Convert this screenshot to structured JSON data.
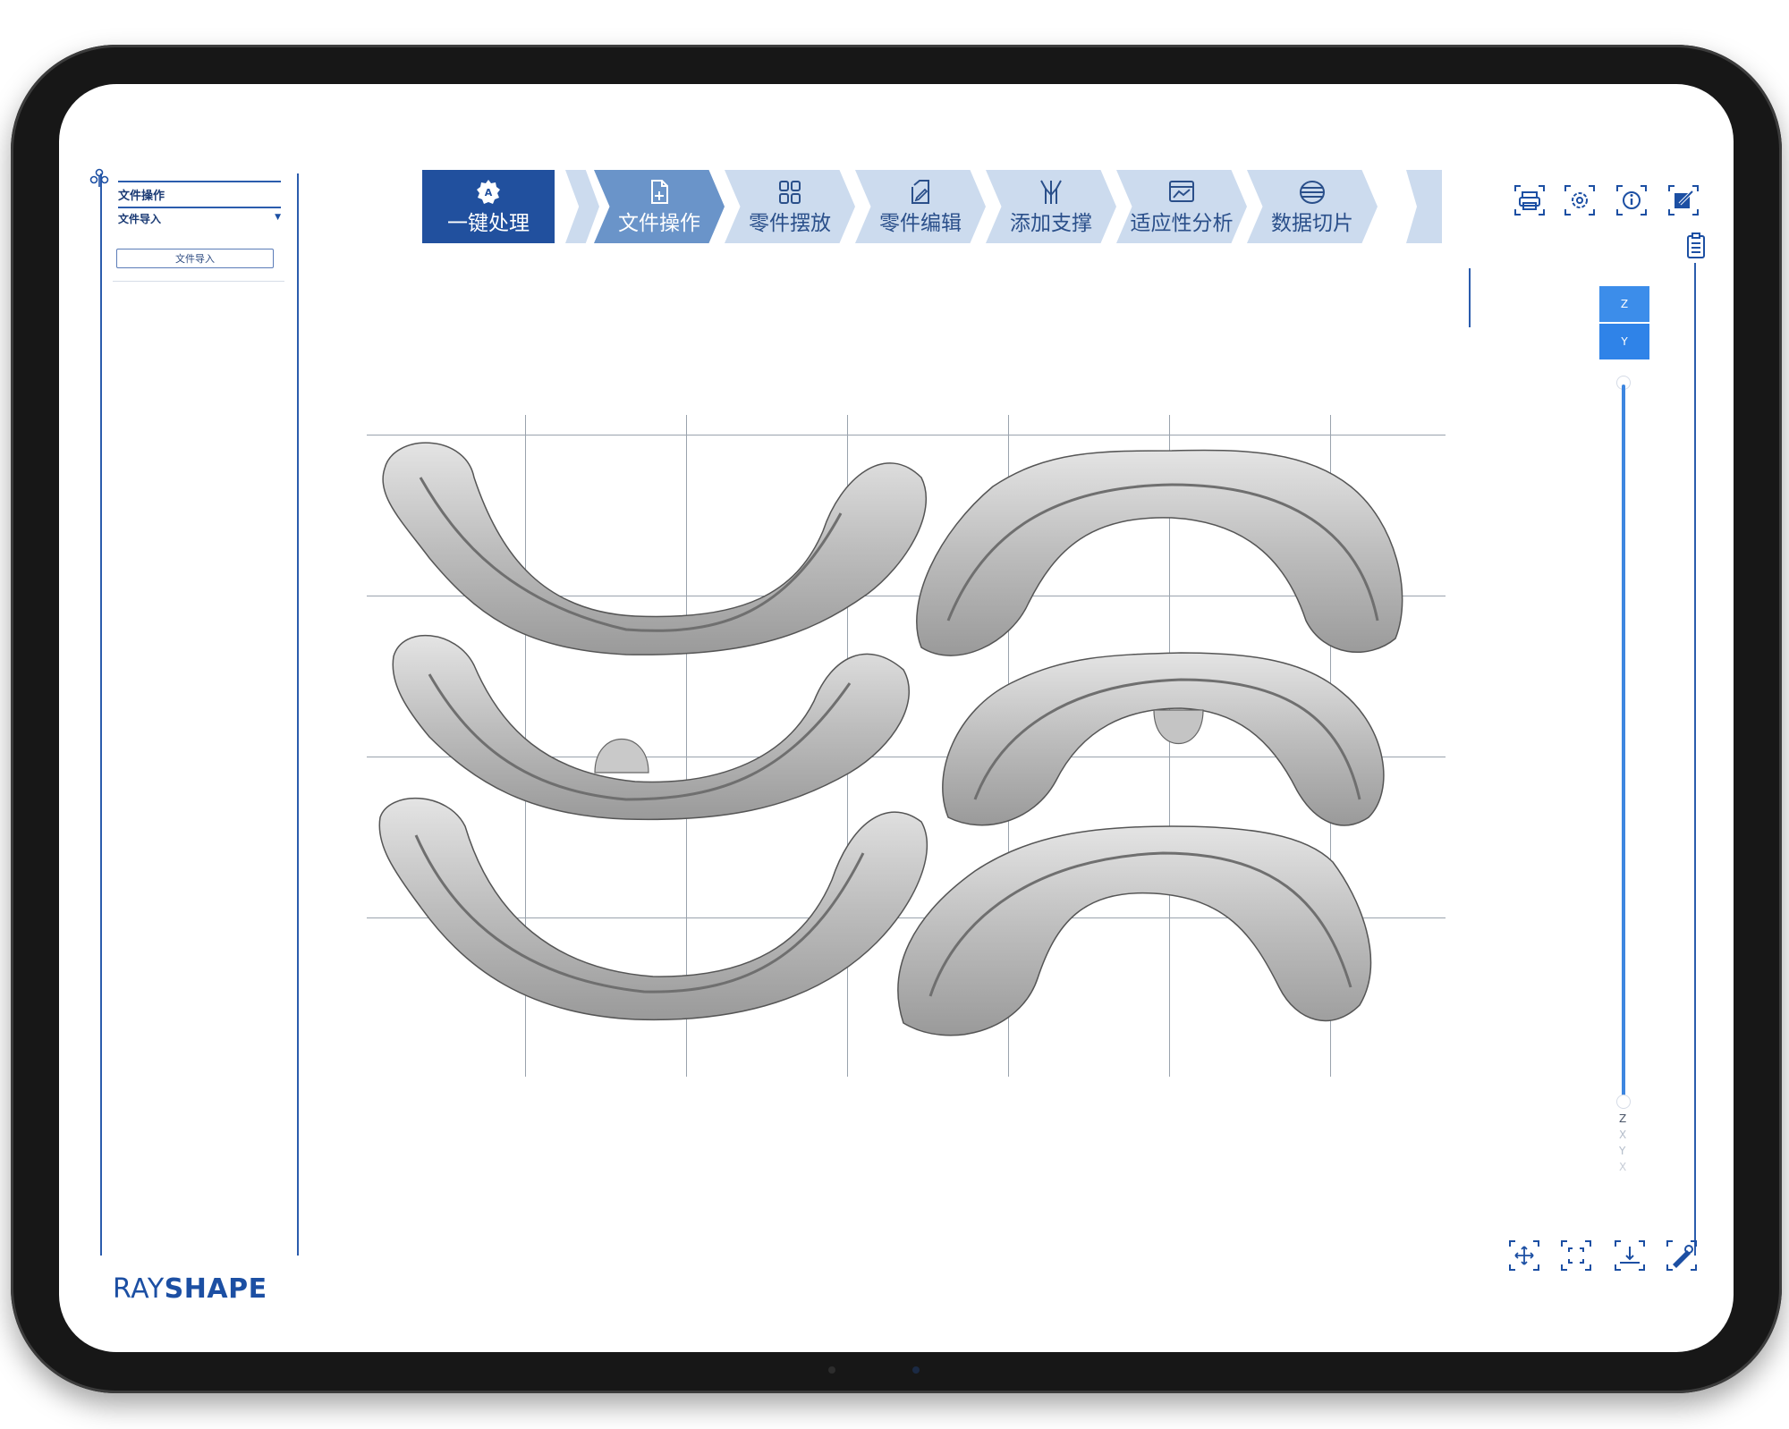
{
  "left_panel": {
    "title": "文件操作",
    "subtitle": "文件导入",
    "import_button": "文件导入"
  },
  "brand": {
    "part1": "RAY",
    "part2": "SHAPE"
  },
  "workflow": {
    "auto": {
      "label": "一键处理",
      "icon": "auto-a-icon"
    },
    "steps": [
      {
        "label": "文件操作",
        "icon": "file-add-icon",
        "active": true
      },
      {
        "label": "零件摆放",
        "icon": "grid-squares-icon",
        "active": false
      },
      {
        "label": "零件编辑",
        "icon": "edit-file-icon",
        "active": false
      },
      {
        "label": "添加支撑",
        "icon": "support-icon",
        "active": false
      },
      {
        "label": "适应性分析",
        "icon": "analysis-icon",
        "active": false
      },
      {
        "label": "数据切片",
        "icon": "slice-layers-icon",
        "active": false
      }
    ]
  },
  "toolbar_top": [
    "print-icon",
    "settings-icon",
    "info-icon",
    "edit-export-icon"
  ],
  "toolbar_bottom": [
    "move-icon",
    "fit-view-icon",
    "platform-icon",
    "repair-icon"
  ],
  "axis_buttons": [
    "Z",
    "Y"
  ],
  "axis_legend": [
    "Z",
    "X",
    "Y",
    "X"
  ],
  "colors": {
    "brand": "#1c4fa3",
    "step_active": "#6a94c9",
    "step_inactive": "#ccdbee",
    "auto_step": "#21509e",
    "axis_button": "#3c8dea",
    "model": "#c8c8c8"
  }
}
